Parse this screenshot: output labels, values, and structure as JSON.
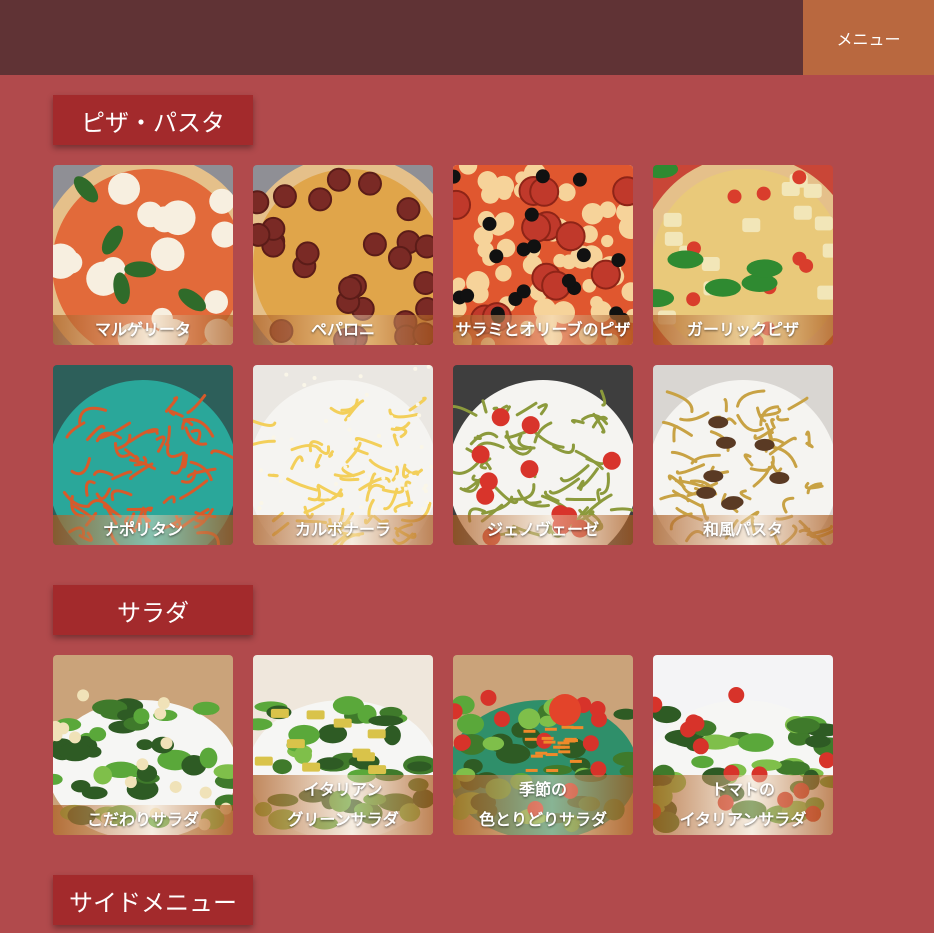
{
  "header": {
    "menu_label": "メニュー"
  },
  "sections": [
    {
      "title": "ピザ・パスタ",
      "items": [
        {
          "name": "マルゲリータ",
          "lines": [
            "マルゲリータ"
          ],
          "kind": "pizza-margherita"
        },
        {
          "name": "ペパロニ",
          "lines": [
            "ペパロニ"
          ],
          "kind": "pizza-pepperoni"
        },
        {
          "name": "サラミとオリーブのピザ",
          "lines": [
            "サラミとオリーブのピザ"
          ],
          "kind": "pizza-olive"
        },
        {
          "name": "ガーリックピザ",
          "lines": [
            "ガーリックピザ"
          ],
          "kind": "pizza-garlic"
        },
        {
          "name": "ナポリタン",
          "lines": [
            "ナポリタン"
          ],
          "kind": "pasta-napolitan"
        },
        {
          "name": "カルボナーラ",
          "lines": [
            "カルボナーラ"
          ],
          "kind": "pasta-carbonara"
        },
        {
          "name": "ジェノヴェーゼ",
          "lines": [
            "ジェノヴェーゼ"
          ],
          "kind": "pasta-genovese"
        },
        {
          "name": "和風パスタ",
          "lines": [
            "和風パスタ"
          ],
          "kind": "pasta-wafu"
        }
      ]
    },
    {
      "title": "サラダ",
      "items": [
        {
          "name": "こだわりサラダ",
          "lines": [
            "こだわりサラダ"
          ],
          "kind": "salad-special"
        },
        {
          "name": "イタリアングリーンサラダ",
          "lines": [
            "イタリアン",
            "グリーンサラダ"
          ],
          "kind": "salad-green"
        },
        {
          "name": "季節の色とりどりサラダ",
          "lines": [
            "季節の",
            "色とりどりサラダ"
          ],
          "kind": "salad-season"
        },
        {
          "name": "トマトのイタリアンサラダ",
          "lines": [
            "トマトの",
            "イタリアンサラダ"
          ],
          "kind": "salad-tomato"
        }
      ]
    },
    {
      "title": "サイドメニュー",
      "items": []
    }
  ]
}
